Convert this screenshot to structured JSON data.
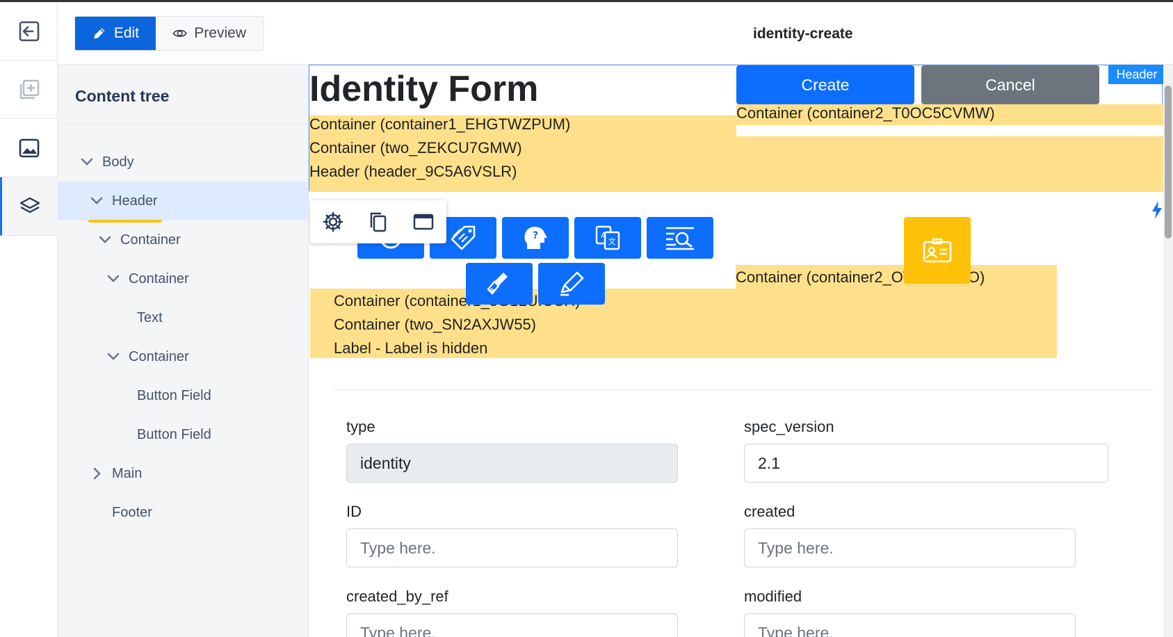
{
  "toolbar": {
    "edit_label": "Edit",
    "preview_label": "Preview",
    "page_name": "identity-create"
  },
  "tree": {
    "title": "Content tree",
    "items": [
      {
        "label": "Body",
        "expanded": true
      },
      {
        "label": "Header",
        "expanded": true,
        "selected": true
      },
      {
        "label": "Container",
        "expanded": true
      },
      {
        "label": "Container",
        "expanded": true
      },
      {
        "label": "Text"
      },
      {
        "label": "Container",
        "expanded": true
      },
      {
        "label": "Button Field"
      },
      {
        "label": "Button Field"
      },
      {
        "label": "Main",
        "expanded": false
      },
      {
        "label": "Footer"
      }
    ]
  },
  "header_block": {
    "title": "Identity Form",
    "create_label": "Create",
    "cancel_label": "Cancel",
    "tag_label": "Header",
    "left_lines": [
      "Container (container1_EHGTWZPUM)",
      "Container (two_ZEKCU7GMW)",
      "Header (header_9C5A6VSLR)"
    ],
    "right_line": "Container (container2_T0OC5CVMW)"
  },
  "body_block": {
    "right_line": "Container (container2_OVOL9649O)",
    "left_lines": [
      "Container (container1_5G1LUICCH)",
      "Container (two_SN2AXJW55)",
      "Label - Label is hidden"
    ]
  },
  "icons": {
    "float_toolbar": [
      "gear-icon",
      "copy-icon",
      "window-icon"
    ],
    "tiles": [
      "tag-icon",
      "head-question-icon",
      "translate-icon",
      "search-list-icon",
      "brush-icon",
      "highlighter-icon"
    ],
    "yellow_tile": "id-card-icon"
  },
  "form": {
    "fields": [
      {
        "label": "type",
        "value": "identity",
        "readonly": true
      },
      {
        "label": "spec_version",
        "value": "2.1"
      },
      {
        "label": "ID",
        "placeholder": "Type here."
      },
      {
        "label": "created",
        "placeholder": "Type here."
      },
      {
        "label": "created_by_ref",
        "placeholder": "Type here."
      },
      {
        "label": "modified",
        "placeholder": "Type here."
      }
    ]
  },
  "colors": {
    "primary": "#0d6efd",
    "secondary": "#6c757d",
    "highlight": "#ffe08a",
    "warning": "#ffc107",
    "tree_bg": "#f4f5f7",
    "tree_selected": "#deebff"
  }
}
